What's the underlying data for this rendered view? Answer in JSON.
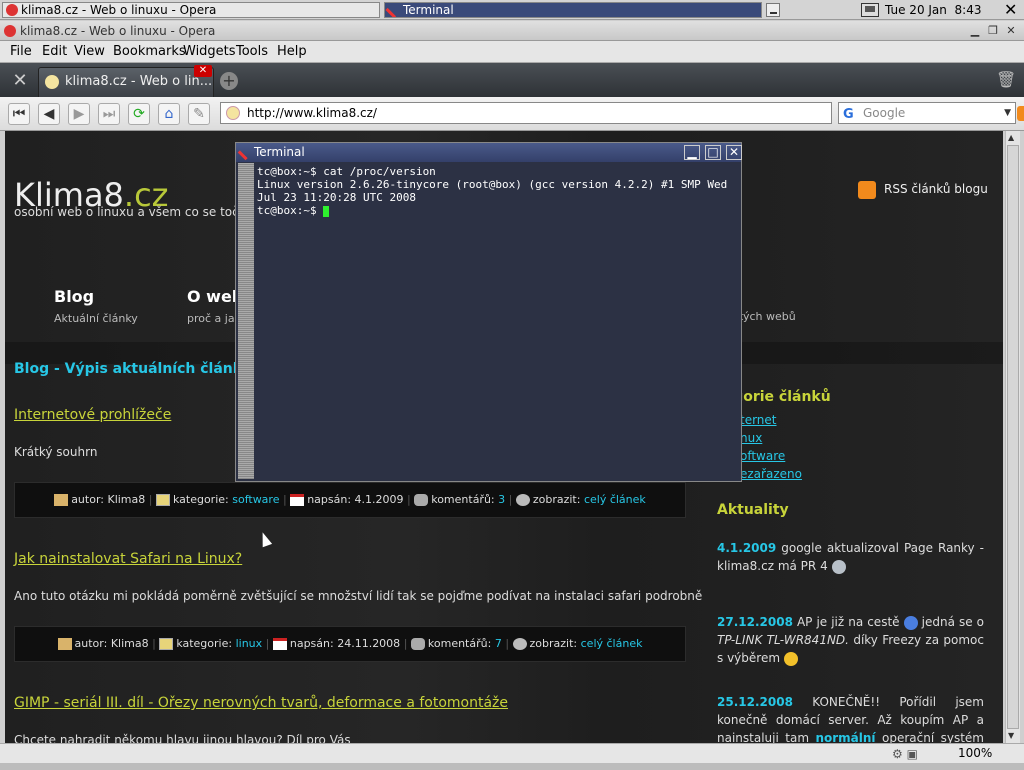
{
  "taskbar": {
    "tasks": [
      {
        "label": "klima8.cz - Web o linuxu - Opera"
      },
      {
        "label": "Terminal"
      }
    ],
    "clock": "Tue 20 Jan  8:43",
    "close": "✕"
  },
  "window": {
    "title": "klima8.cz - Web o linuxu - Opera"
  },
  "menu": {
    "items": [
      "File",
      "Edit",
      "View",
      "Bookmarks",
      "Widgets",
      "Tools",
      "Help"
    ]
  },
  "tabs": [
    {
      "label": "klima8.cz - Web o lin..."
    }
  ],
  "address": {
    "url": "http://www.klima8.cz/",
    "search_placeholder": "Google"
  },
  "status": {
    "zoom": "100%"
  },
  "site": {
    "logo_main": "Klima8",
    "logo_suffix": ".cz",
    "tagline": "osobní web o linuxu a všem co se toči ko",
    "rss": "RSS článků blogu",
    "nav": [
      {
        "title": "Blog",
        "sub": "Aktuální články"
      },
      {
        "title": "O web",
        "sub": "proč a jak"
      }
    ],
    "nav_rest": "kých webů",
    "heading": "Blog - Výpis aktuálních článků",
    "posts": [
      {
        "title": "Internetové prohlížeče",
        "excerpt": "Krátký souhrn",
        "author": "autor: Klima8",
        "category_label": "kategorie:",
        "category": "software",
        "date": "napsán: 4.1.2009",
        "comments_label": "komentářů:",
        "comments": "3",
        "view_label": "zobrazit:",
        "view_link": "celý článek"
      },
      {
        "title": "Jak nainstalovat Safari na Linux?",
        "excerpt": "Ano tuto otázku mi pokládá poměrně zvětšující se množství lidí tak se pojďme podívat na instalaci safari podrobně",
        "author": "autor: Klima8",
        "category_label": "kategorie:",
        "category": "linux",
        "date": "napsán: 24.11.2008",
        "comments_label": "komentářů:",
        "comments": "7",
        "view_label": "zobrazit:",
        "view_link": "celý článek"
      },
      {
        "title": "GIMP - seriál III. díl - Ořezy nerovných tvarů, deformace a fotomontáže",
        "excerpt": "Chcete nahradit někomu hlavu jinou hlavou? Díl pro Vás"
      }
    ],
    "sidebar": {
      "heading": "tegorie článků",
      "links": [
        "ternet",
        "nux",
        "oftware",
        "ezařazeno"
      ],
      "news_heading": "Aktuality",
      "news": [
        {
          "date": "4.1.2009",
          "text": "google aktualizoval Page Ranky - klima8.cz má PR 4"
        },
        {
          "date": "27.12.2008",
          "text": "AP je již na cestě",
          "text2": "jedná se o",
          "em": "TP-LINK TL-WR841ND.",
          "text3": "díky Freezy za pomoc s výběrem"
        },
        {
          "date": "25.12.2008",
          "text": "KONEČNĚ!! Pořídil jsem konečně domácí server. Až koupím AP a nainstaluji tam",
          "bold": "normální",
          "text2": "operační systém místo toho co tam je"
        }
      ]
    }
  },
  "terminal": {
    "title": "Terminal",
    "lines": [
      "tc@box:~$ cat /proc/version",
      "Linux version 2.6.26-tinycore (root@box) (gcc version 4.2.2) #1 SMP Wed Jul 23 11:20:28 UTC 2008",
      "tc@box:~$ "
    ]
  }
}
